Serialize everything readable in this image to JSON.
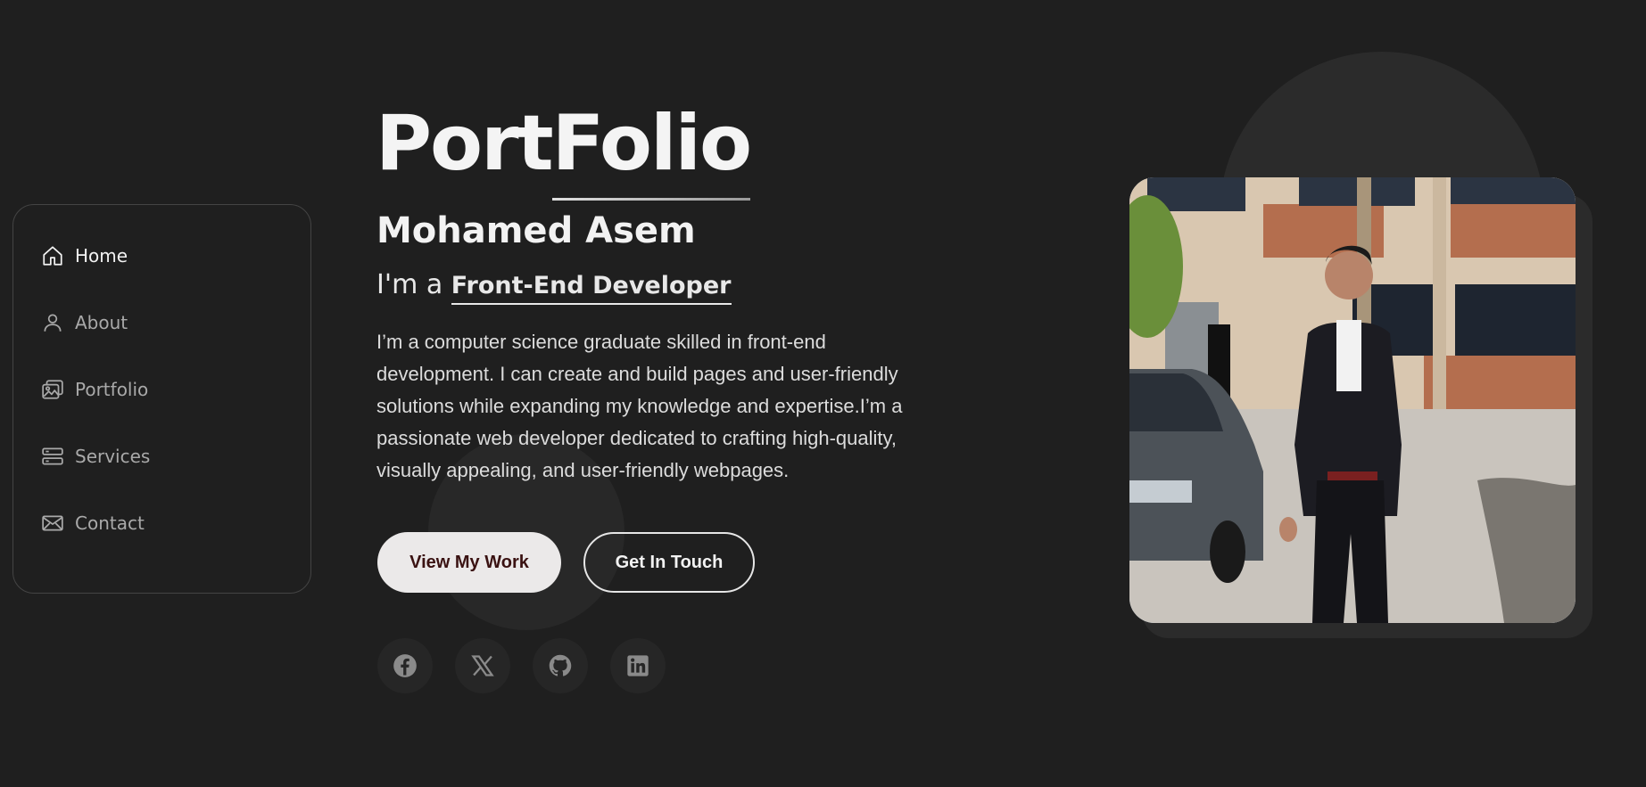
{
  "sidebar": {
    "items": [
      {
        "label": "Home",
        "icon": "home-icon",
        "active": true
      },
      {
        "label": "About",
        "icon": "user-icon",
        "active": false
      },
      {
        "label": "Portfolio",
        "icon": "images-icon",
        "active": false
      },
      {
        "label": "Services",
        "icon": "server-icon",
        "active": false
      },
      {
        "label": "Contact",
        "icon": "envelope-icon",
        "active": false
      }
    ]
  },
  "hero": {
    "title_part1": "Port",
    "title_part2": "Folio",
    "name": "Mohamed Asem",
    "role_prefix": "I'm a ",
    "role": "Front-End Developer",
    "bio": "I’m a computer science graduate skilled in front-end development. I can create and build pages and user-friendly solutions while expanding my knowledge and expertise.I’m a passionate web developer dedicated to crafting high-quality, visually appealing, and user-friendly webpages.",
    "primary_button": "View My Work",
    "secondary_button": "Get In Touch"
  },
  "social": [
    "facebook-icon",
    "x-twitter-icon",
    "github-icon",
    "linkedin-icon"
  ],
  "colors": {
    "background": "#1f1f1f",
    "text": "#f2f2f2",
    "muted": "#a9a9a9",
    "primary_button_bg": "#ebe9e9",
    "primary_button_text": "#3a1212"
  }
}
